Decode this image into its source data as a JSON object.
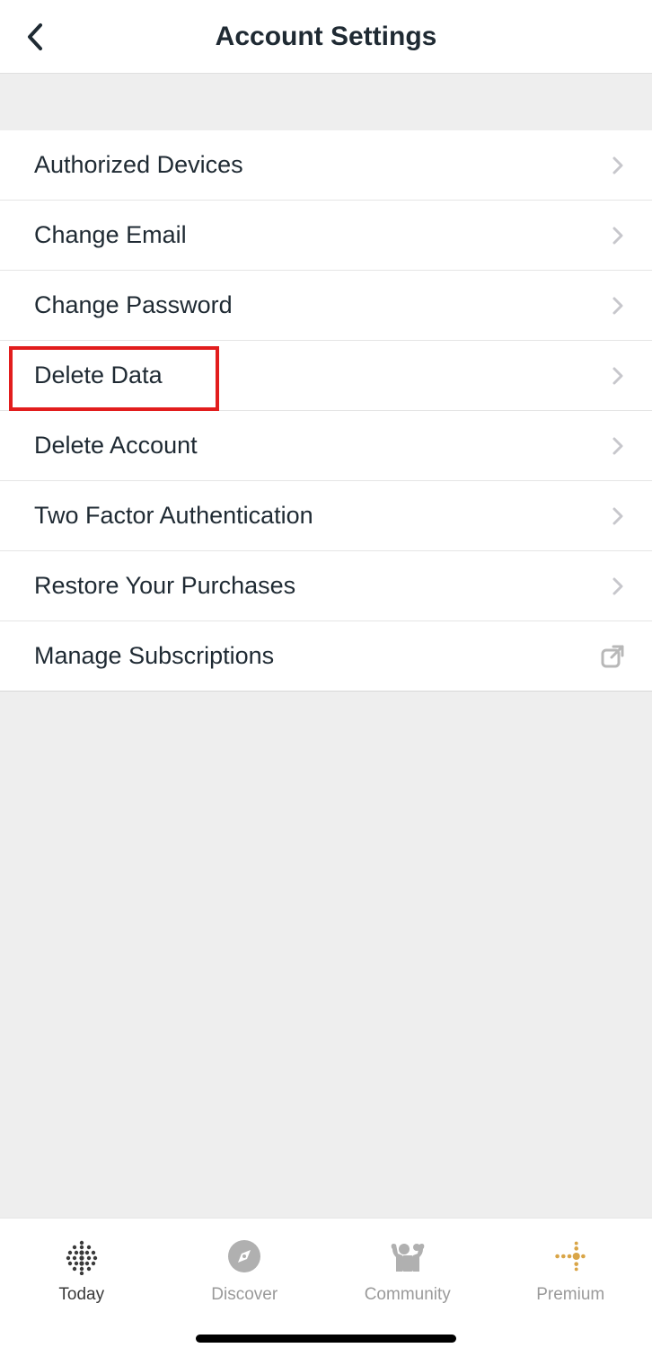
{
  "header": {
    "title": "Account Settings"
  },
  "settings": {
    "items": [
      {
        "label": "Authorized Devices",
        "icon": "chevron"
      },
      {
        "label": "Change Email",
        "icon": "chevron"
      },
      {
        "label": "Change Password",
        "icon": "chevron"
      },
      {
        "label": "Delete Data",
        "icon": "chevron"
      },
      {
        "label": "Delete Account",
        "icon": "chevron"
      },
      {
        "label": "Two Factor Authentication",
        "icon": "chevron"
      },
      {
        "label": "Restore Your Purchases",
        "icon": "chevron"
      },
      {
        "label": "Manage Subscriptions",
        "icon": "external"
      }
    ]
  },
  "nav": {
    "items": [
      {
        "label": "Today",
        "active": true
      },
      {
        "label": "Discover",
        "active": false
      },
      {
        "label": "Community",
        "active": false
      },
      {
        "label": "Premium",
        "active": false
      }
    ]
  },
  "highlight": {
    "target_index": 3
  }
}
